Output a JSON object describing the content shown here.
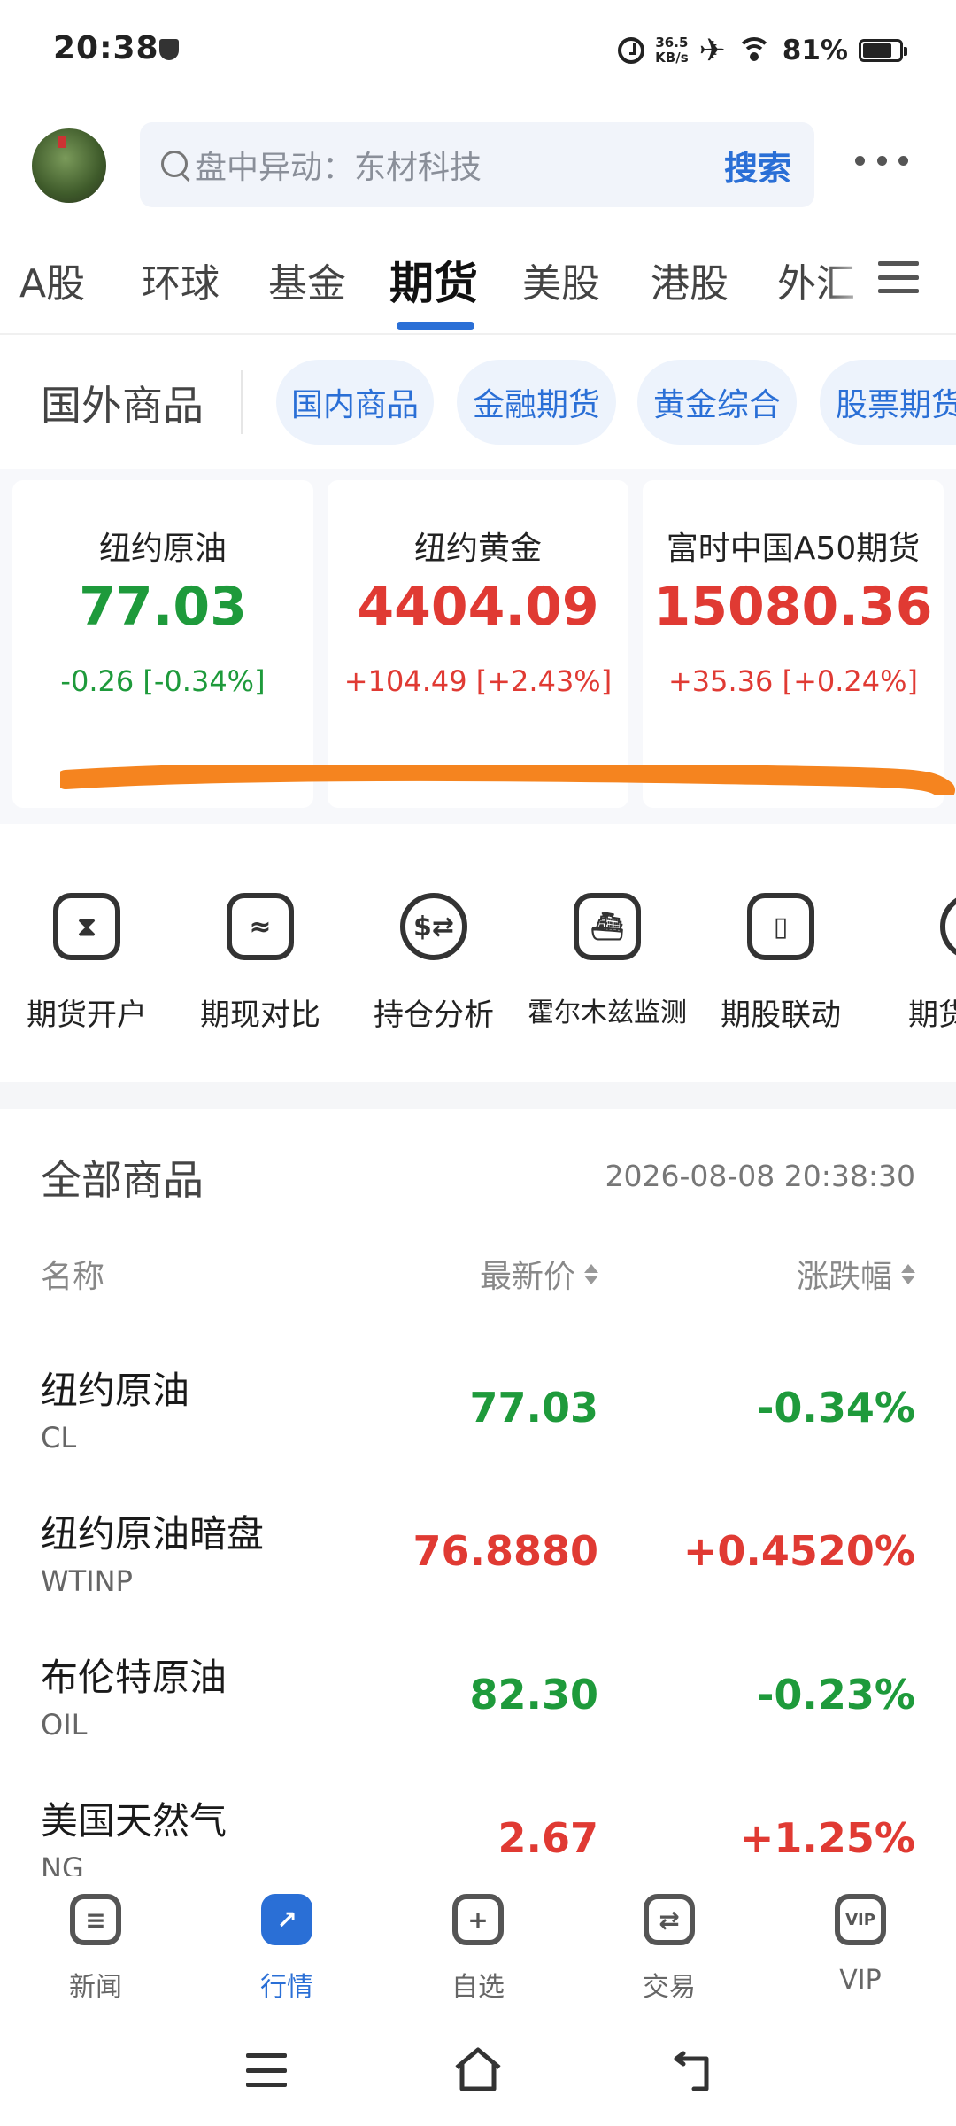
{
  "status_bar": {
    "time": "20:38",
    "net_speed_value": "36.5",
    "net_speed_unit": "KB/s",
    "battery": "81%",
    "battery_level": 0.81
  },
  "header": {
    "search_placeholder": "盘中异动：东材科技",
    "search_button": "搜索"
  },
  "main_tabs": [
    {
      "label": "A股",
      "active": false
    },
    {
      "label": "环球",
      "active": false
    },
    {
      "label": "基金",
      "active": false
    },
    {
      "label": "期货",
      "active": true
    },
    {
      "label": "美股",
      "active": false
    },
    {
      "label": "港股",
      "active": false
    },
    {
      "label": "外汇",
      "active": false
    }
  ],
  "sub_tabs": {
    "current": "国外商品",
    "chips": [
      "国内商品",
      "金融期货",
      "黄金综合",
      "股票期货"
    ]
  },
  "quote_cards": [
    {
      "name": "纽约原油",
      "price": "77.03",
      "change": "-0.26 [-0.34%]",
      "trend": "down"
    },
    {
      "name": "纽约黄金",
      "price": "4404.09",
      "change": "+104.49 [+2.43%]",
      "trend": "up"
    },
    {
      "name": "富时中国A50期货",
      "price": "15080.36",
      "change": "+35.36 [+0.24%]",
      "trend": "up"
    }
  ],
  "tools": [
    {
      "label": "期货开户",
      "icon": "hourglass-plus-icon"
    },
    {
      "label": "期现对比",
      "icon": "compare-wave-icon"
    },
    {
      "label": "持仓分析",
      "icon": "exchange-circle-icon"
    },
    {
      "label": "霍尔木兹监测",
      "icon": "ship-icon"
    },
    {
      "label": "期股联动",
      "icon": "candlestick-link-icon"
    },
    {
      "label": "期货",
      "icon": "chat-face-icon"
    }
  ],
  "list": {
    "title": "全部商品",
    "timestamp": "2026-08-08 20:38:30",
    "col_name": "名称",
    "col_price": "最新价",
    "col_change": "涨跌幅",
    "rows": [
      {
        "name": "纽约原油",
        "code": "CL",
        "price": "77.03",
        "pct": "-0.34%",
        "trend": "down"
      },
      {
        "name": "纽约原油暗盘",
        "code": "WTINP",
        "price": "76.8880",
        "pct": "+0.4520%",
        "trend": "up"
      },
      {
        "name": "布伦特原油",
        "code": "OIL",
        "price": "82.30",
        "pct": "-0.23%",
        "trend": "down"
      },
      {
        "name": "美国天然气",
        "code": "NG",
        "price": "2.67",
        "pct": "+1.25%",
        "trend": "up"
      }
    ]
  },
  "bottom_nav": [
    {
      "label": "新闻",
      "icon": "news-icon",
      "active": false
    },
    {
      "label": "行情",
      "icon": "market-chart-icon",
      "active": true
    },
    {
      "label": "自选",
      "icon": "add-watchlist-icon",
      "active": false
    },
    {
      "label": "交易",
      "icon": "trade-icon",
      "active": false
    },
    {
      "label": "VIP",
      "icon": "vip-icon",
      "active": false
    }
  ],
  "colors": {
    "accent": "#2a6fd6",
    "up": "#e03a33",
    "down": "#1e9a3b",
    "highlight_stroke": "#f5841f"
  }
}
